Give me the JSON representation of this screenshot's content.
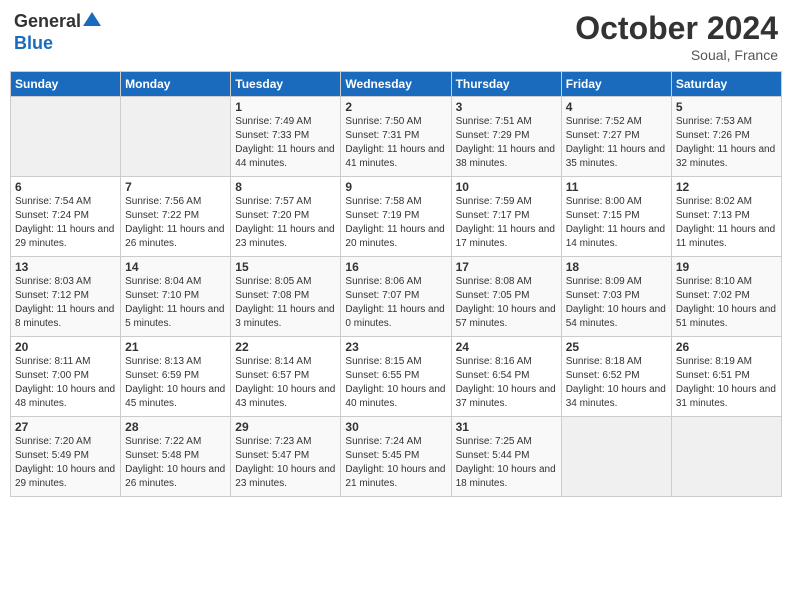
{
  "header": {
    "logo_general": "General",
    "logo_blue": "Blue",
    "month_title": "October 2024",
    "location": "Soual, France"
  },
  "days_of_week": [
    "Sunday",
    "Monday",
    "Tuesday",
    "Wednesday",
    "Thursday",
    "Friday",
    "Saturday"
  ],
  "weeks": [
    [
      {
        "day": "",
        "content": ""
      },
      {
        "day": "",
        "content": ""
      },
      {
        "day": "1",
        "content": "Sunrise: 7:49 AM\nSunset: 7:33 PM\nDaylight: 11 hours and 44 minutes."
      },
      {
        "day": "2",
        "content": "Sunrise: 7:50 AM\nSunset: 7:31 PM\nDaylight: 11 hours and 41 minutes."
      },
      {
        "day": "3",
        "content": "Sunrise: 7:51 AM\nSunset: 7:29 PM\nDaylight: 11 hours and 38 minutes."
      },
      {
        "day": "4",
        "content": "Sunrise: 7:52 AM\nSunset: 7:27 PM\nDaylight: 11 hours and 35 minutes."
      },
      {
        "day": "5",
        "content": "Sunrise: 7:53 AM\nSunset: 7:26 PM\nDaylight: 11 hours and 32 minutes."
      }
    ],
    [
      {
        "day": "6",
        "content": "Sunrise: 7:54 AM\nSunset: 7:24 PM\nDaylight: 11 hours and 29 minutes."
      },
      {
        "day": "7",
        "content": "Sunrise: 7:56 AM\nSunset: 7:22 PM\nDaylight: 11 hours and 26 minutes."
      },
      {
        "day": "8",
        "content": "Sunrise: 7:57 AM\nSunset: 7:20 PM\nDaylight: 11 hours and 23 minutes."
      },
      {
        "day": "9",
        "content": "Sunrise: 7:58 AM\nSunset: 7:19 PM\nDaylight: 11 hours and 20 minutes."
      },
      {
        "day": "10",
        "content": "Sunrise: 7:59 AM\nSunset: 7:17 PM\nDaylight: 11 hours and 17 minutes."
      },
      {
        "day": "11",
        "content": "Sunrise: 8:00 AM\nSunset: 7:15 PM\nDaylight: 11 hours and 14 minutes."
      },
      {
        "day": "12",
        "content": "Sunrise: 8:02 AM\nSunset: 7:13 PM\nDaylight: 11 hours and 11 minutes."
      }
    ],
    [
      {
        "day": "13",
        "content": "Sunrise: 8:03 AM\nSunset: 7:12 PM\nDaylight: 11 hours and 8 minutes."
      },
      {
        "day": "14",
        "content": "Sunrise: 8:04 AM\nSunset: 7:10 PM\nDaylight: 11 hours and 5 minutes."
      },
      {
        "day": "15",
        "content": "Sunrise: 8:05 AM\nSunset: 7:08 PM\nDaylight: 11 hours and 3 minutes."
      },
      {
        "day": "16",
        "content": "Sunrise: 8:06 AM\nSunset: 7:07 PM\nDaylight: 11 hours and 0 minutes."
      },
      {
        "day": "17",
        "content": "Sunrise: 8:08 AM\nSunset: 7:05 PM\nDaylight: 10 hours and 57 minutes."
      },
      {
        "day": "18",
        "content": "Sunrise: 8:09 AM\nSunset: 7:03 PM\nDaylight: 10 hours and 54 minutes."
      },
      {
        "day": "19",
        "content": "Sunrise: 8:10 AM\nSunset: 7:02 PM\nDaylight: 10 hours and 51 minutes."
      }
    ],
    [
      {
        "day": "20",
        "content": "Sunrise: 8:11 AM\nSunset: 7:00 PM\nDaylight: 10 hours and 48 minutes."
      },
      {
        "day": "21",
        "content": "Sunrise: 8:13 AM\nSunset: 6:59 PM\nDaylight: 10 hours and 45 minutes."
      },
      {
        "day": "22",
        "content": "Sunrise: 8:14 AM\nSunset: 6:57 PM\nDaylight: 10 hours and 43 minutes."
      },
      {
        "day": "23",
        "content": "Sunrise: 8:15 AM\nSunset: 6:55 PM\nDaylight: 10 hours and 40 minutes."
      },
      {
        "day": "24",
        "content": "Sunrise: 8:16 AM\nSunset: 6:54 PM\nDaylight: 10 hours and 37 minutes."
      },
      {
        "day": "25",
        "content": "Sunrise: 8:18 AM\nSunset: 6:52 PM\nDaylight: 10 hours and 34 minutes."
      },
      {
        "day": "26",
        "content": "Sunrise: 8:19 AM\nSunset: 6:51 PM\nDaylight: 10 hours and 31 minutes."
      }
    ],
    [
      {
        "day": "27",
        "content": "Sunrise: 7:20 AM\nSunset: 5:49 PM\nDaylight: 10 hours and 29 minutes."
      },
      {
        "day": "28",
        "content": "Sunrise: 7:22 AM\nSunset: 5:48 PM\nDaylight: 10 hours and 26 minutes."
      },
      {
        "day": "29",
        "content": "Sunrise: 7:23 AM\nSunset: 5:47 PM\nDaylight: 10 hours and 23 minutes."
      },
      {
        "day": "30",
        "content": "Sunrise: 7:24 AM\nSunset: 5:45 PM\nDaylight: 10 hours and 21 minutes."
      },
      {
        "day": "31",
        "content": "Sunrise: 7:25 AM\nSunset: 5:44 PM\nDaylight: 10 hours and 18 minutes."
      },
      {
        "day": "",
        "content": ""
      },
      {
        "day": "",
        "content": ""
      }
    ]
  ]
}
